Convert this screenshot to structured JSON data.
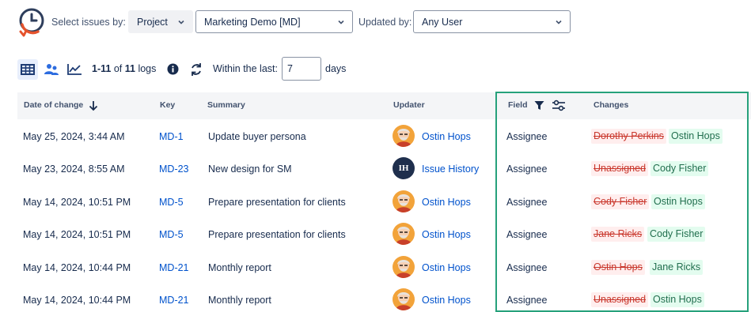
{
  "filters": {
    "select_issues_label": "Select issues by:",
    "select_by_value": "Project",
    "project_value": "Marketing Demo [MD]",
    "updated_by_label": "Updated by:",
    "updated_by_value": "Any User"
  },
  "toolbar": {
    "range": "1-11",
    "of": "of",
    "total": "11",
    "logs": "logs",
    "within_label": "Within the last:",
    "days_value": "7",
    "days_label": "days"
  },
  "table": {
    "headers": {
      "date": "Date of change",
      "key": "Key",
      "summary": "Summary",
      "updater": "Updater",
      "field": "Field",
      "changes": "Changes"
    },
    "rows": [
      {
        "date": "May 25, 2024, 3:44 AM",
        "key": "MD-1",
        "summary": "Update buyer persona",
        "updater": "Ostin Hops",
        "avatar": "photo",
        "field": "Assignee",
        "old": "Dorothy Perkins",
        "new": "Ostin Hops"
      },
      {
        "date": "May 23, 2024, 8:55 AM",
        "key": "MD-23",
        "summary": "New design for SM",
        "updater": "Issue History",
        "avatar": "IH",
        "field": "Assignee",
        "old": "Unassigned",
        "new": "Cody Fisher"
      },
      {
        "date": "May 14, 2024, 10:51 PM",
        "key": "MD-5",
        "summary": "Prepare presentation for clients",
        "updater": "Ostin Hops",
        "avatar": "photo",
        "field": "Assignee",
        "old": "Cody Fisher",
        "new": "Ostin Hops"
      },
      {
        "date": "May 14, 2024, 10:51 PM",
        "key": "MD-5",
        "summary": "Prepare presentation for clients",
        "updater": "Ostin Hops",
        "avatar": "photo",
        "field": "Assignee",
        "old": "Jane Ricks",
        "new": "Cody Fisher"
      },
      {
        "date": "May 14, 2024, 10:44 PM",
        "key": "MD-21",
        "summary": "Monthly report",
        "updater": "Ostin Hops",
        "avatar": "photo",
        "field": "Assignee",
        "old": "Ostin Hops",
        "new": "Jane Ricks"
      },
      {
        "date": "May 14, 2024, 10:44 PM",
        "key": "MD-21",
        "summary": "Monthly report",
        "updater": "Ostin Hops",
        "avatar": "photo",
        "field": "Assignee",
        "old": "Unassigned",
        "new": "Ostin Hops"
      }
    ]
  },
  "colors": {
    "accent": "#0052cc",
    "highlight": "#26a17b",
    "old_text": "#c9372c",
    "new_text": "#216e4e",
    "logo_orange": "#e5532d",
    "logo_navy": "#2e3e5c"
  }
}
